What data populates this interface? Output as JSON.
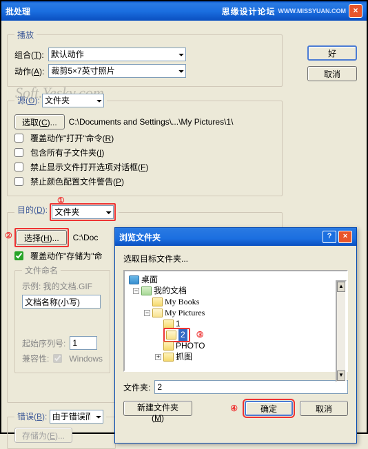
{
  "titlebar": {
    "title": "批处理",
    "brand": "思缘设计论坛",
    "sub": "WWW.MISSYUAN.COM"
  },
  "buttons": {
    "ok": "好",
    "cancel": "取消",
    "choose_src": "选取(C)...",
    "choose_dst": "选择(H)...",
    "saveas": "存储为(E)..."
  },
  "playback": {
    "legend": "播放",
    "set_label": "组合(T):",
    "set_value": "默认动作",
    "action_label": "动作(A):",
    "action_value": "裁剪5×7英寸照片"
  },
  "source": {
    "legend_prefix": "源(O):",
    "value": "文件夹",
    "path": "C:\\Documents and Settings\\...\\My Pictures\\1\\",
    "cb1": "覆盖动作\"打开\"命令(R)",
    "cb2": "包含所有子文件夹(I)",
    "cb3": "禁止显示文件打开选项对话框(F)",
    "cb4": "禁止颜色配置文件警告(P)"
  },
  "dest": {
    "legend_prefix": "目的(D):",
    "value": "文件夹",
    "path": "C:\\Doc",
    "cb_override": "覆盖动作\"存储为\"命令",
    "legend2": "文件命名",
    "example": "示例: 我的文档.GIF",
    "fname_value": "文档名称(小写)",
    "startseq_label": "起始序列号:",
    "startseq_value": "1",
    "compat_label": "兼容性:",
    "compat_value": "Windows"
  },
  "errors": {
    "label": "错误(B):",
    "value": "由于错误而"
  },
  "annotations": {
    "a1": "①",
    "a2": "②",
    "a3": "③",
    "a4": "④"
  },
  "watermark": "Soft.Yesky.com",
  "dialog": {
    "title": "浏览文件夹",
    "prompt": "选取目标文件夹...",
    "tree": {
      "desktop": "桌面",
      "mydocs": "我的文档",
      "mybooks": "My Books",
      "mypics": "My Pictures",
      "n1": "1",
      "n2": "2",
      "photo": "PHOTO",
      "zhuatu": "抓图"
    },
    "folder_label": "文件夹:",
    "folder_value": "2",
    "newfolder": "新建文件夹 (M)",
    "ok": "确定",
    "cancel": "取消"
  }
}
